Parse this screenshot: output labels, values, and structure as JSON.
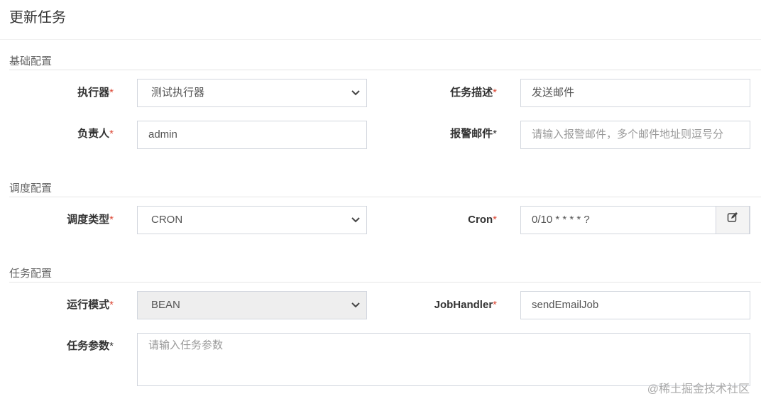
{
  "title": "更新任务",
  "sections": {
    "basic": "基础配置",
    "schedule": "调度配置",
    "task": "任务配置"
  },
  "fields": {
    "executor": {
      "label": "执行器",
      "value": "测试执行器"
    },
    "desc": {
      "label": "任务描述",
      "value": "发送邮件"
    },
    "owner": {
      "label": "负责人",
      "value": "admin"
    },
    "alarm": {
      "label": "报警邮件",
      "placeholder": "请输入报警邮件，多个邮件地址则逗号分"
    },
    "schedType": {
      "label": "调度类型",
      "value": "CRON"
    },
    "cron": {
      "label": "Cron",
      "value": "0/10 * * * * ?"
    },
    "runMode": {
      "label": "运行模式",
      "value": "BEAN"
    },
    "handler": {
      "label": "JobHandler",
      "value": "sendEmailJob"
    },
    "params": {
      "label": "任务参数",
      "placeholder": "请输入任务参数"
    }
  },
  "required_mark": "*",
  "watermark": "@稀土掘金技术社区"
}
